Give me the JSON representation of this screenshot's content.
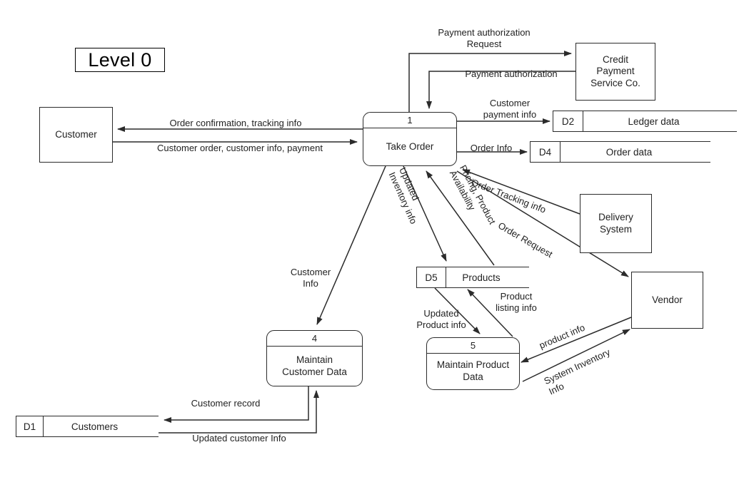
{
  "diagram": {
    "title": "Level 0",
    "type": "data-flow-diagram"
  },
  "external_entities": [
    {
      "id": "customer",
      "label": "Customer"
    },
    {
      "id": "credit_service",
      "label": "Credit\nPayment\nService Co."
    },
    {
      "id": "delivery",
      "label": "Delivery\nSystem"
    },
    {
      "id": "vendor",
      "label": "Vendor"
    }
  ],
  "processes": [
    {
      "id": "p1",
      "number": "1",
      "name": "Take Order"
    },
    {
      "id": "p4",
      "number": "4",
      "name": "Maintain\nCustomer Data"
    },
    {
      "id": "p5",
      "number": "5",
      "name": "Maintain Product\nData"
    }
  ],
  "data_stores": [
    {
      "id": "d1",
      "code": "D1",
      "label": "Customers"
    },
    {
      "id": "d2",
      "code": "D2",
      "label": "Ledger data"
    },
    {
      "id": "d4",
      "code": "D4",
      "label": "Order data"
    },
    {
      "id": "d5",
      "code": "D5",
      "label": "Products"
    }
  ],
  "flows": [
    {
      "id": "f1",
      "label": "Payment authorization\nRequest",
      "from": "p1",
      "to": "credit_service"
    },
    {
      "id": "f2",
      "label": "Payment authorization",
      "from": "credit_service",
      "to": "p1"
    },
    {
      "id": "f3",
      "label": "Customer\npayment info",
      "from": "p1",
      "to": "d2"
    },
    {
      "id": "f4",
      "label": "Order Info",
      "from": "p1",
      "to": "d4"
    },
    {
      "id": "f5",
      "label": "Order confirmation, tracking info",
      "from": "p1",
      "to": "customer"
    },
    {
      "id": "f6",
      "label": "Customer order, customer info, payment",
      "from": "customer",
      "to": "p1"
    },
    {
      "id": "f7",
      "label": "Customer\nInfo",
      "from": "p1",
      "to": "p4"
    },
    {
      "id": "f8",
      "label": "Updated\nInventory info",
      "from": "p1",
      "to": "d5"
    },
    {
      "id": "f9",
      "label": "Pricing, Product\nAvailability",
      "from": "d5",
      "to": "p1"
    },
    {
      "id": "f10",
      "label": "Order Tracking info",
      "from": "delivery",
      "to": "p1"
    },
    {
      "id": "f11",
      "label": "Order Request",
      "from": "p1",
      "to": "vendor"
    },
    {
      "id": "f12",
      "label": "Updated\nProduct info",
      "from": "d5",
      "to": "p5"
    },
    {
      "id": "f13",
      "label": "Product\nlisting info",
      "from": "p5",
      "to": "d5"
    },
    {
      "id": "f14",
      "label": "product info",
      "from": "vendor",
      "to": "p5"
    },
    {
      "id": "f15",
      "label": "System Inventory\nInfo",
      "from": "p5",
      "to": "vendor"
    },
    {
      "id": "f16",
      "label": "Customer record",
      "from": "p4",
      "to": "d1"
    },
    {
      "id": "f17",
      "label": "Updated customer Info",
      "from": "d1",
      "to": "p4"
    }
  ],
  "colors": {
    "stroke": "#2b2b2b",
    "text": "#222222",
    "background": "#ffffff"
  }
}
